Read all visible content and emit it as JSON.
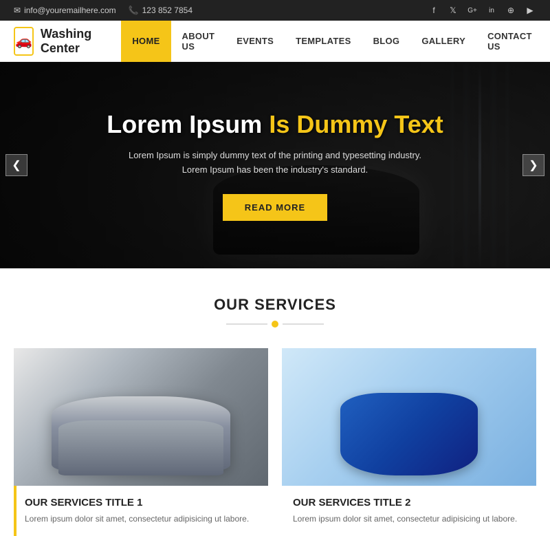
{
  "topbar": {
    "email": "info@youremailhere.com",
    "phone": "123 852 7854",
    "email_icon": "✉",
    "phone_icon": "📞"
  },
  "social": [
    {
      "name": "facebook",
      "label": "f"
    },
    {
      "name": "twitter",
      "label": "𝕏"
    },
    {
      "name": "google-plus",
      "label": "G+"
    },
    {
      "name": "linkedin",
      "label": "in"
    },
    {
      "name": "rss",
      "label": "⊕"
    },
    {
      "name": "youtube",
      "label": "▶"
    }
  ],
  "header": {
    "logo_icon": "🚗",
    "logo_text": "Washing Center",
    "nav": [
      {
        "label": "HOME",
        "active": true
      },
      {
        "label": "ABOUT US",
        "active": false
      },
      {
        "label": "EVENTS",
        "active": false
      },
      {
        "label": "TEMPLATES",
        "active": false
      },
      {
        "label": "BLOG",
        "active": false
      },
      {
        "label": "GALLERY",
        "active": false
      },
      {
        "label": "CONTACT US",
        "active": false
      }
    ]
  },
  "hero": {
    "title_white": "Lorem Ipsum",
    "title_yellow": "Is Dummy Text",
    "subtitle_line1": "Lorem Ipsum is simply dummy text of the printing and typesetting industry.",
    "subtitle_line2": "Lorem Ipsum has been the industry's standard.",
    "cta_label": "READ MORE",
    "arrow_left": "❮",
    "arrow_right": "❯"
  },
  "services": {
    "section_title": "OUR SERVICES",
    "cards": [
      {
        "title": "OUR SERVICES TITLE 1",
        "text": "Lorem ipsum dolor sit amet, consectetur adipisicing ut labore."
      },
      {
        "title": "OUR SERVICES TITLE 2",
        "text": "Lorem ipsum dolor sit amet, consectetur adipisicing ut labore."
      }
    ]
  }
}
